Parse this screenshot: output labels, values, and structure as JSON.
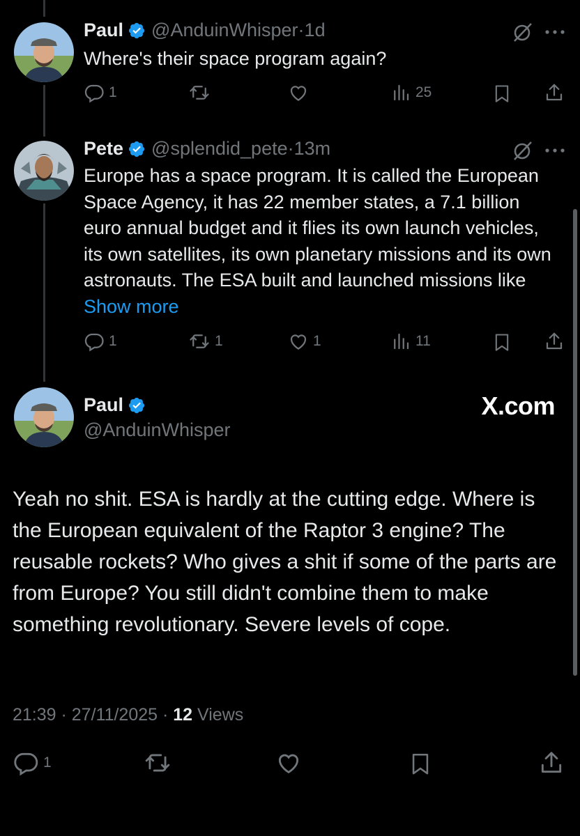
{
  "tweets": [
    {
      "name": "Paul",
      "handle": "@AnduinWhisper",
      "time_sep": " · ",
      "time": "1d",
      "text": "Where's their space program again?",
      "actions": {
        "replies": "1",
        "reposts": "",
        "likes": "",
        "views": "25"
      }
    },
    {
      "name": "Pete",
      "handle": "@splendid_pete",
      "time_sep": " · ",
      "time": "13m",
      "text": "Europe has a space program. It is called the European Space Agency, it has 22 member states, a 7.1 billion euro annual budget and it flies its own launch vehicles, its own satellites, its own planetary missions and its own astronauts. The ESA built and launched missions like ",
      "show_more": "Show more",
      "actions": {
        "replies": "1",
        "reposts": "1",
        "likes": "1",
        "views": "11"
      }
    }
  ],
  "main": {
    "name": "Paul",
    "handle": "@AnduinWhisper",
    "watermark": "X.com",
    "text": "Yeah no shit. ESA is hardly at the cutting edge. Where is the European equivalent of the Raptor 3 engine? The reusable rockets? Who gives a shit if some of the parts are from Europe? You still didn't combine them to make something revolutionary. Severe levels of cope.",
    "timestamp": "21:39 · 27/11/2025 · ",
    "views_count": "12",
    "views_label": " Views",
    "actions": {
      "replies": "1"
    }
  },
  "colors": {
    "background": "#000000",
    "text": "#e7e9ea",
    "muted": "#71767b",
    "link": "#1d9bf0",
    "verified": "#1d9bf0"
  },
  "icons": [
    "reply-icon",
    "repost-icon",
    "like-icon",
    "views-icon",
    "bookmark-icon",
    "share-icon",
    "grok-icon",
    "more-icon",
    "verified-badge-icon"
  ]
}
